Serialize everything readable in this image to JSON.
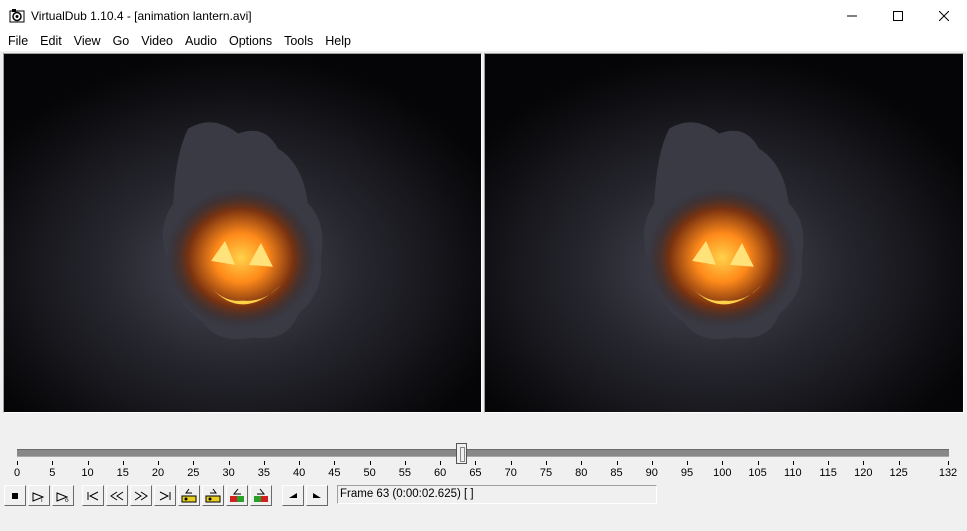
{
  "window": {
    "title": "VirtualDub 1.10.4 - [animation lantern.avi]",
    "controls": [
      "minimize",
      "maximize",
      "close"
    ]
  },
  "menu": [
    "File",
    "Edit",
    "View",
    "Go",
    "Video",
    "Audio",
    "Options",
    "Tools",
    "Help"
  ],
  "panes": {
    "input": {
      "content": "jack-o-lantern-image"
    },
    "output": {
      "content": "jack-o-lantern-image"
    }
  },
  "timeline": {
    "position_frame": 63,
    "max_frame": 132,
    "tick_labels": [
      "0",
      "5",
      "10",
      "15",
      "20",
      "25",
      "30",
      "35",
      "40",
      "45",
      "50",
      "55",
      "60",
      "65",
      "70",
      "75",
      "80",
      "85",
      "90",
      "95",
      "100",
      "105",
      "110",
      "115",
      "120",
      "125",
      "132"
    ]
  },
  "toolbar": {
    "buttons": [
      {
        "name": "stop-button",
        "icon": "stop-icon"
      },
      {
        "name": "play-input-button",
        "icon": "play-input-icon"
      },
      {
        "name": "play-output-button",
        "icon": "play-output-icon"
      },
      {
        "name": "start-button",
        "icon": "go-start-icon"
      },
      {
        "name": "prev-frame-button",
        "icon": "prev-frame-icon"
      },
      {
        "name": "next-frame-button",
        "icon": "next-frame-icon"
      },
      {
        "name": "end-button",
        "icon": "go-end-icon"
      },
      {
        "name": "prev-keyframe-button",
        "icon": "prev-keyframe-icon"
      },
      {
        "name": "next-keyframe-button",
        "icon": "next-keyframe-icon"
      },
      {
        "name": "prev-scene-button",
        "icon": "prev-scene-icon"
      },
      {
        "name": "next-scene-button",
        "icon": "next-scene-icon"
      },
      {
        "name": "mark-in-button",
        "icon": "mark-in-icon"
      },
      {
        "name": "mark-out-button",
        "icon": "mark-out-icon"
      }
    ]
  },
  "status": {
    "frame_text": "Frame 63 (0:00:02.625) [ ]"
  }
}
